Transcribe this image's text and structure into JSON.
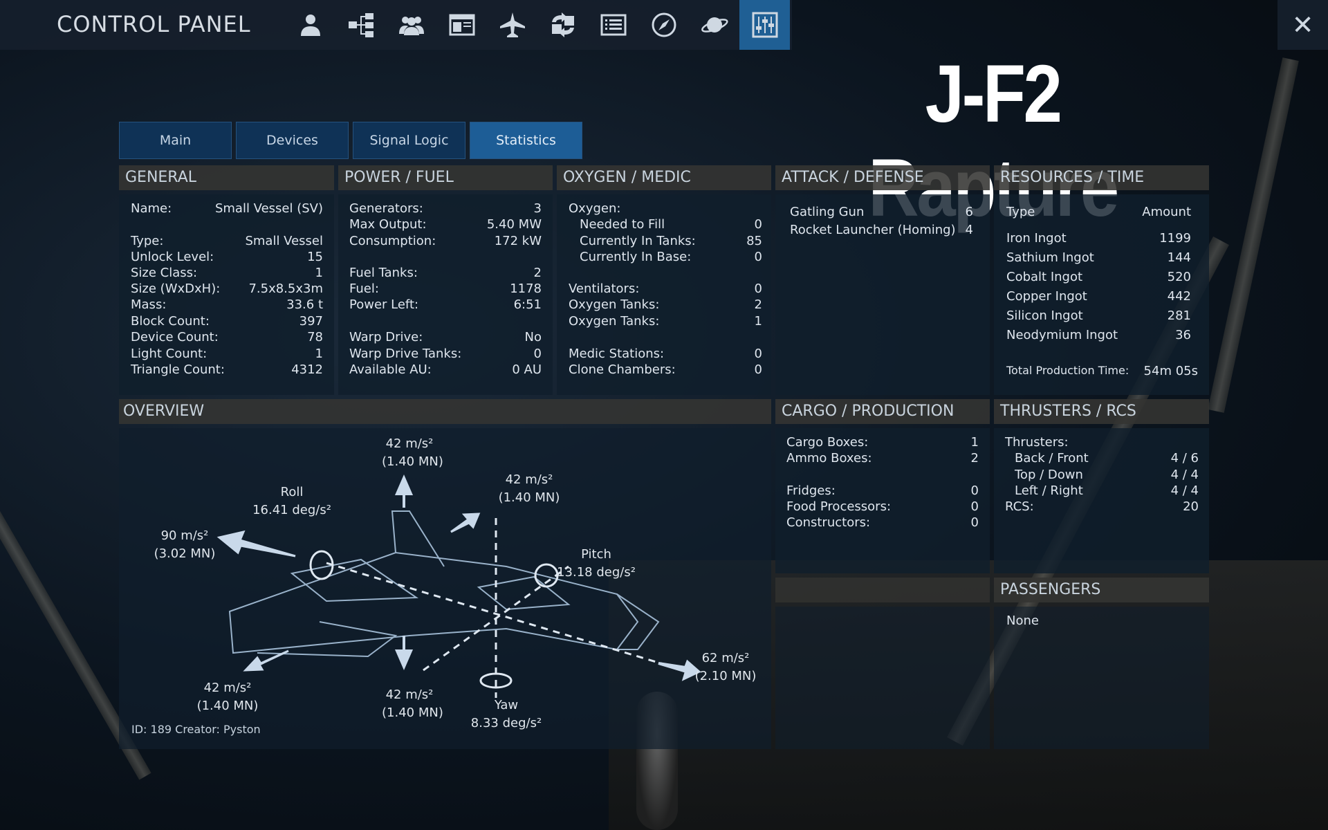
{
  "topbar": {
    "title": "CONTROL PANEL",
    "icons": [
      "player-icon",
      "structure-tree-icon",
      "faction-icon",
      "window-icon",
      "vessel-icon",
      "exchange-icon",
      "list-icon",
      "compass-icon",
      "planet-icon",
      "control-panel-icon"
    ],
    "active_icon": "control-panel-icon",
    "close_label": "✕"
  },
  "ship_name": "J-F2 Rapture",
  "tabs": [
    {
      "label": "Main"
    },
    {
      "label": "Devices"
    },
    {
      "label": "Signal Logic"
    },
    {
      "label": "Statistics",
      "active": true
    }
  ],
  "general": {
    "title": "GENERAL",
    "rows": [
      {
        "k": "Name:",
        "v": "Small Vessel (SV)"
      },
      {
        "k": "Type:",
        "v": "Small Vessel"
      },
      {
        "k": "Unlock Level:",
        "v": "15"
      },
      {
        "k": "Size Class:",
        "v": "1"
      },
      {
        "k": "Size (WxDxH):",
        "v": "7.5x8.5x3m"
      },
      {
        "k": "Mass:",
        "v": "33.6 t"
      },
      {
        "k": "Block Count:",
        "v": "397"
      },
      {
        "k": "Device Count:",
        "v": "78"
      },
      {
        "k": "Light Count:",
        "v": "1"
      },
      {
        "k": "Triangle Count:",
        "v": "4312"
      }
    ]
  },
  "power": {
    "title": "POWER / FUEL",
    "rows": [
      {
        "k": "Generators:",
        "v": "3"
      },
      {
        "k": "Max Output:",
        "v": "5.40 MW"
      },
      {
        "k": "Consumption:",
        "v": "172 kW"
      },
      {
        "k": "Fuel Tanks:",
        "v": "2"
      },
      {
        "k": "Fuel:",
        "v": "1178"
      },
      {
        "k": "Power Left:",
        "v": "6:51"
      },
      {
        "k": "Warp Drive:",
        "v": "No"
      },
      {
        "k": "Warp Drive Tanks:",
        "v": "0"
      },
      {
        "k": "Available AU:",
        "v": "0 AU"
      }
    ]
  },
  "oxygen": {
    "title": "OXYGEN / MEDIC",
    "rows": [
      {
        "k": "Oxygen:",
        "v": ""
      },
      {
        "k": "Needed to Fill",
        "v": "0"
      },
      {
        "k": "Currently In Tanks:",
        "v": "85"
      },
      {
        "k": "Currently In Base:",
        "v": "0"
      },
      {
        "k": "Ventilators:",
        "v": "0"
      },
      {
        "k": "Oxygen Tanks:",
        "v": "2"
      },
      {
        "k": "Oxygen Tanks:",
        "v": "1"
      },
      {
        "k": "Medic Stations:",
        "v": "0"
      },
      {
        "k": "Clone Chambers:",
        "v": "0"
      }
    ]
  },
  "attack": {
    "title": "ATTACK / DEFENSE",
    "rows": [
      {
        "k": "Gatling Gun",
        "v": "6"
      },
      {
        "k": "Rocket Launcher (Homing)",
        "v": "4"
      }
    ]
  },
  "resources": {
    "title": "RESOURCES / TIME",
    "col_type": "Type",
    "col_amount": "Amount",
    "rows": [
      {
        "k": "Iron Ingot",
        "v": "1199"
      },
      {
        "k": "Sathium Ingot",
        "v": "144"
      },
      {
        "k": "Cobalt Ingot",
        "v": "520"
      },
      {
        "k": "Copper Ingot",
        "v": "442"
      },
      {
        "k": "Silicon Ingot",
        "v": "281"
      },
      {
        "k": "Neodymium Ingot",
        "v": "36"
      }
    ],
    "total_label": "Total Production Time:",
    "total_value": "54m 05s"
  },
  "overview": {
    "title": "OVERVIEW",
    "up": {
      "value": "42 m/s²",
      "force": "(1.40 MN)"
    },
    "forward_up": {
      "value": "42 m/s²",
      "force": "(1.40 MN)"
    },
    "roll": {
      "name": "Roll",
      "value": "16.41 deg/s²"
    },
    "left": {
      "value": "90 m/s²",
      "force": "(3.02 MN)"
    },
    "pitch": {
      "name": "Pitch",
      "value": "13.18 deg/s²"
    },
    "back": {
      "value": "62 m/s²",
      "force": "(2.10 MN)"
    },
    "left_down": {
      "value": "42 m/s²",
      "force": "(1.40 MN)"
    },
    "down": {
      "value": "42 m/s²",
      "force": "(1.40 MN)"
    },
    "yaw": {
      "name": "Yaw",
      "value": "8.33 deg/s²"
    },
    "footer": "ID: 189 Creator: Pyston"
  },
  "cargo": {
    "title": "CARGO / PRODUCTION",
    "rows": [
      {
        "k": "Cargo Boxes:",
        "v": "1"
      },
      {
        "k": "Ammo Boxes:",
        "v": "2"
      },
      {
        "k": "Fridges:",
        "v": "0"
      },
      {
        "k": "Food Processors:",
        "v": "0"
      },
      {
        "k": "Constructors:",
        "v": "0"
      }
    ]
  },
  "thrusters": {
    "title": "THRUSTERS / RCS",
    "rows": [
      {
        "k": "Thrusters:",
        "v": ""
      },
      {
        "k": "Back / Front",
        "v": "4 / 6"
      },
      {
        "k": "Top / Down",
        "v": "4 / 4"
      },
      {
        "k": "Left / Right",
        "v": "4 / 4"
      },
      {
        "k": "RCS:",
        "v": "20"
      }
    ]
  },
  "passengers": {
    "title": "PASSENGERS",
    "value": "None"
  }
}
